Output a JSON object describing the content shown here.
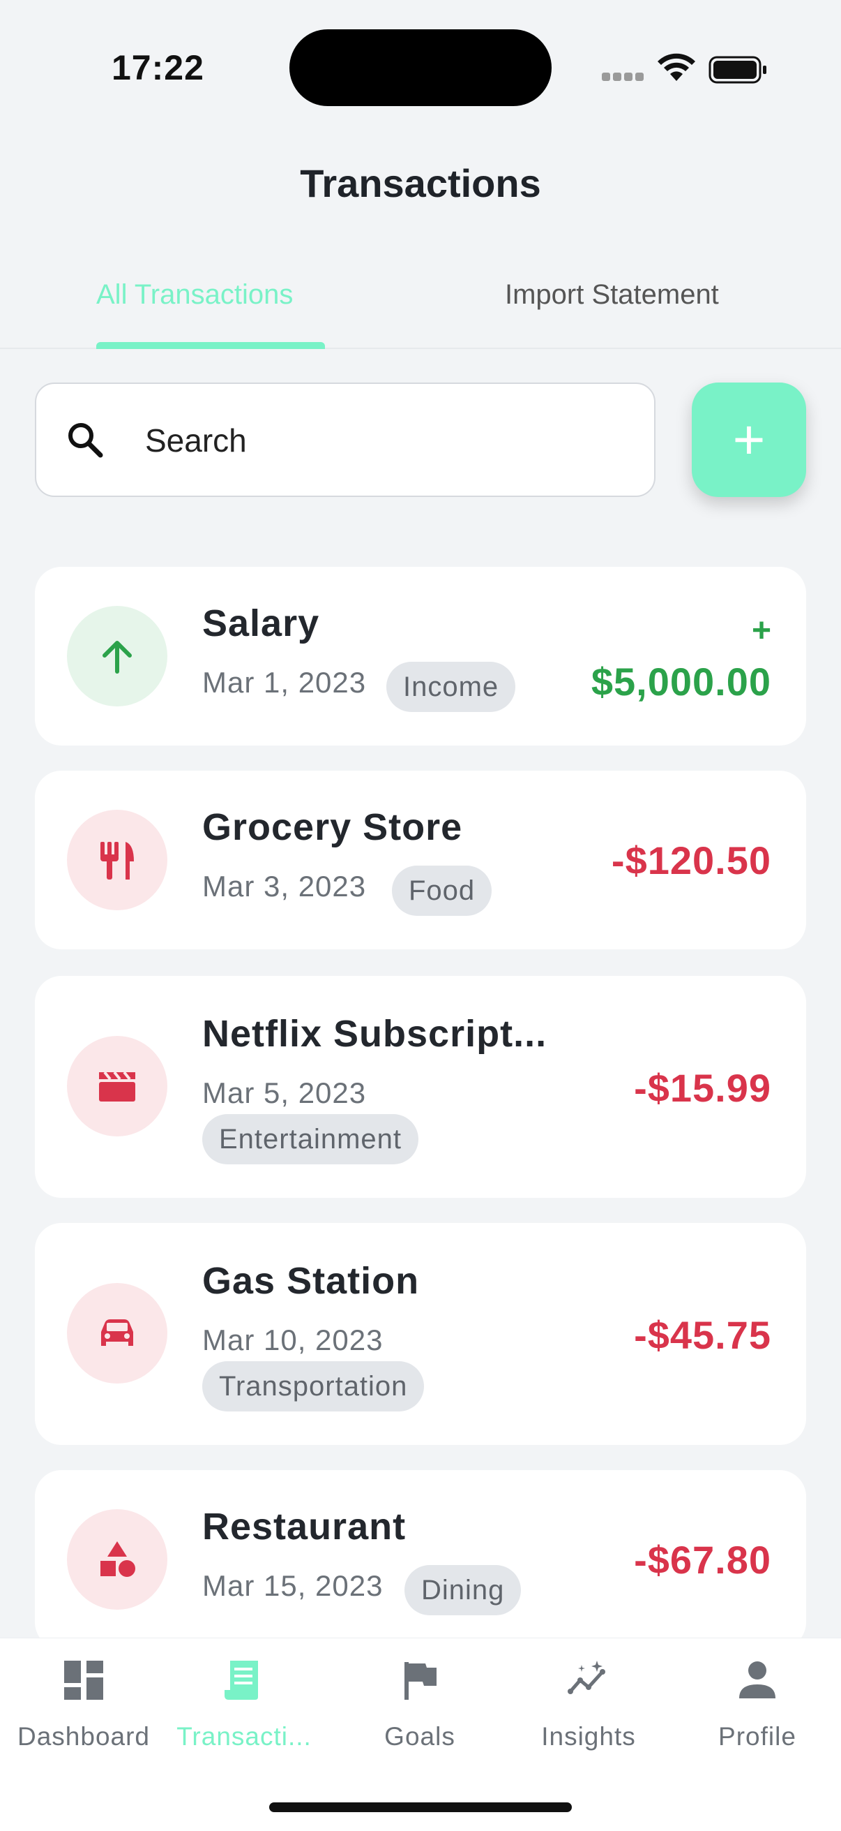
{
  "status_bar": {
    "time": "17:22"
  },
  "header": {
    "title": "Transactions"
  },
  "tabs": [
    {
      "label": "All Transactions",
      "active": true
    },
    {
      "label": "Import Statement",
      "active": false
    }
  ],
  "search": {
    "placeholder": "Search",
    "value": ""
  },
  "add_button": {
    "label": "+"
  },
  "transactions": [
    {
      "name": "Salary",
      "date": "Mar 1, 2023",
      "category": "Income",
      "amount": "$5,000.00",
      "sign": "+",
      "type": "income",
      "icon": "arrow-up-icon"
    },
    {
      "name": "Grocery Store",
      "date": "Mar 3, 2023",
      "category": "Food",
      "amount": "-$120.50",
      "type": "expense",
      "icon": "fork-knife-icon"
    },
    {
      "name": "Netflix Subscript...",
      "date": "Mar 5, 2023",
      "category": "Entertainment",
      "amount": "-$15.99",
      "type": "expense",
      "icon": "clapperboard-icon"
    },
    {
      "name": "Gas Station",
      "date": "Mar 10, 2023",
      "category": "Transportation",
      "amount": "-$45.75",
      "type": "expense",
      "icon": "car-icon"
    },
    {
      "name": "Restaurant",
      "date": "Mar 15, 2023",
      "category": "Dining",
      "amount": "-$67.80",
      "type": "expense",
      "icon": "shapes-icon"
    }
  ],
  "nav": [
    {
      "label": "Dashboard",
      "icon": "dashboard-icon",
      "active": false
    },
    {
      "label": "Transacti...",
      "icon": "receipt-icon",
      "active": true
    },
    {
      "label": "Goals",
      "icon": "flag-icon",
      "active": false
    },
    {
      "label": "Insights",
      "icon": "insights-icon",
      "active": false
    },
    {
      "label": "Profile",
      "icon": "person-icon",
      "active": false
    }
  ],
  "colors": {
    "accent": "#79f2c7",
    "income": "#2ba24a",
    "expense": "#d9344b",
    "chip_bg": "#e3e6ea",
    "background": "#f2f4f6"
  }
}
